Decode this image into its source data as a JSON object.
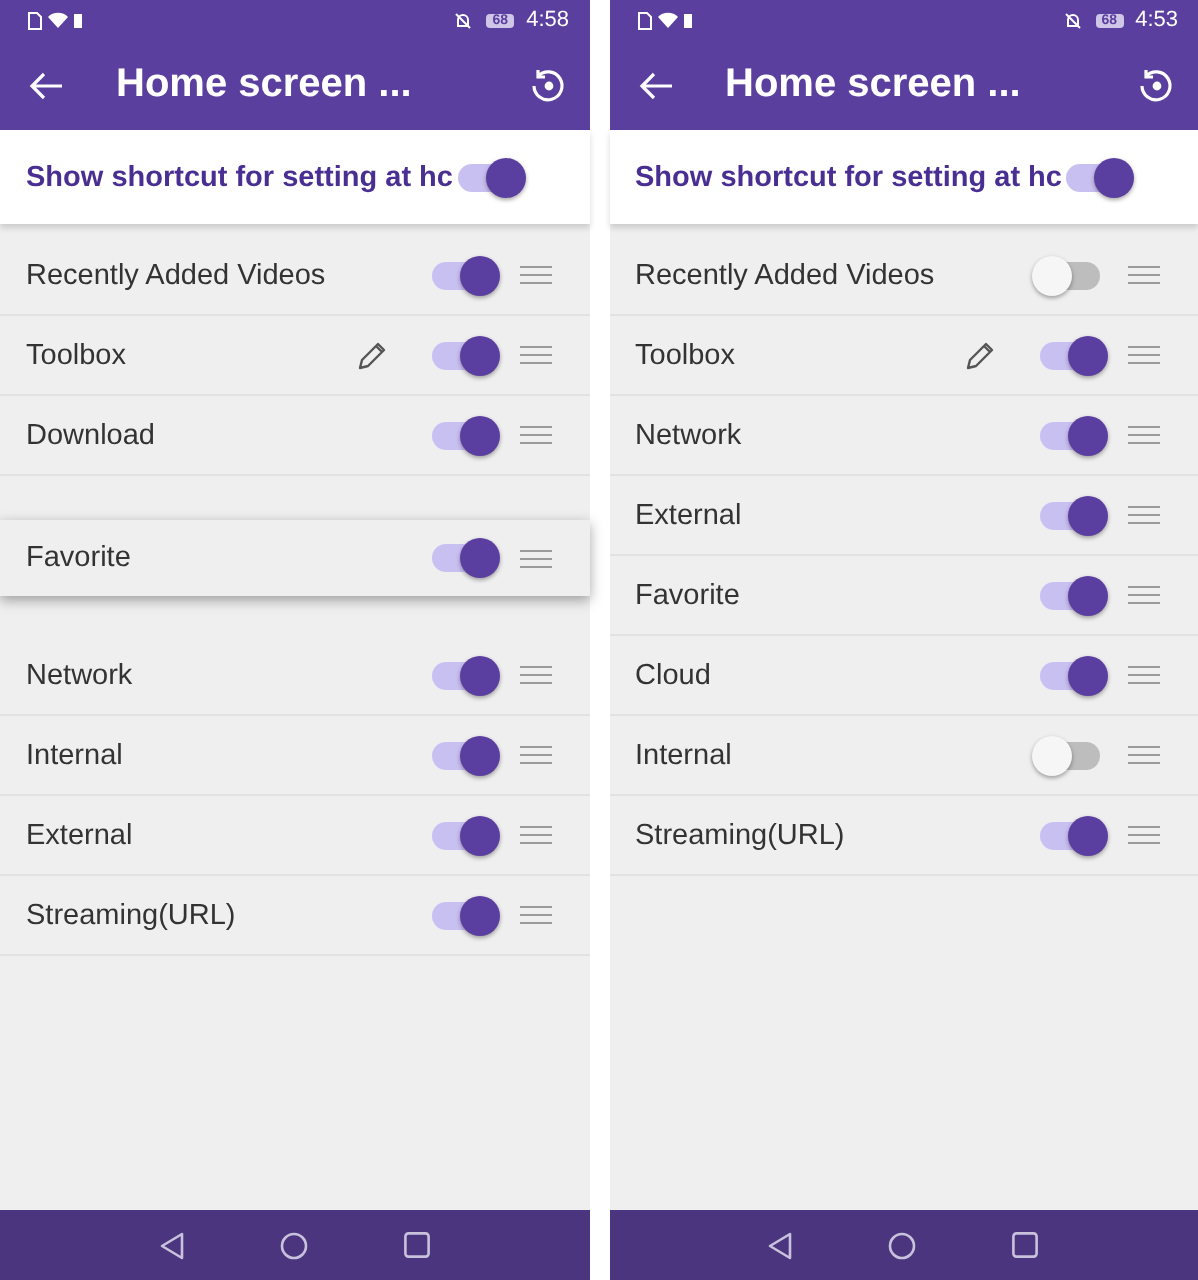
{
  "phones": [
    {
      "status_bar": {
        "battery": "68",
        "time": "4:58"
      },
      "toolbar": {
        "title": "Home screen ..."
      },
      "master": {
        "label": "Show shortcut for setting at hc",
        "on": true
      },
      "items": [
        {
          "label": "Recently Added Videos",
          "on": true,
          "editable": false,
          "dragging": false
        },
        {
          "label": "Toolbox",
          "on": true,
          "editable": true,
          "dragging": false
        },
        {
          "label": "Download",
          "on": true,
          "editable": false,
          "dragging": false
        },
        {
          "kind": "covered_top"
        },
        {
          "label": "Favorite",
          "on": true,
          "editable": false,
          "dragging": true
        },
        {
          "kind": "covered_bottom"
        },
        {
          "label": "Network",
          "on": true,
          "editable": false,
          "dragging": false
        },
        {
          "label": "Internal",
          "on": true,
          "editable": false,
          "dragging": false
        },
        {
          "label": "External",
          "on": true,
          "editable": false,
          "dragging": false
        },
        {
          "label": "Streaming(URL)",
          "on": true,
          "editable": false,
          "dragging": false
        }
      ]
    },
    {
      "status_bar": {
        "battery": "68",
        "time": "4:53"
      },
      "toolbar": {
        "title": "Home screen ..."
      },
      "master": {
        "label": "Show shortcut for setting at hc",
        "on": true
      },
      "items": [
        {
          "label": "Recently Added Videos",
          "on": false,
          "editable": false,
          "dragging": false
        },
        {
          "label": "Toolbox",
          "on": true,
          "editable": true,
          "dragging": false
        },
        {
          "label": "Network",
          "on": true,
          "editable": false,
          "dragging": false
        },
        {
          "label": "External",
          "on": true,
          "editable": false,
          "dragging": false
        },
        {
          "label": "Favorite",
          "on": true,
          "editable": false,
          "dragging": false
        },
        {
          "label": "Cloud",
          "on": true,
          "editable": false,
          "dragging": false
        },
        {
          "label": "Internal",
          "on": false,
          "editable": false,
          "dragging": false
        },
        {
          "label": "Streaming(URL)",
          "on": true,
          "editable": false,
          "dragging": false
        }
      ]
    }
  ]
}
